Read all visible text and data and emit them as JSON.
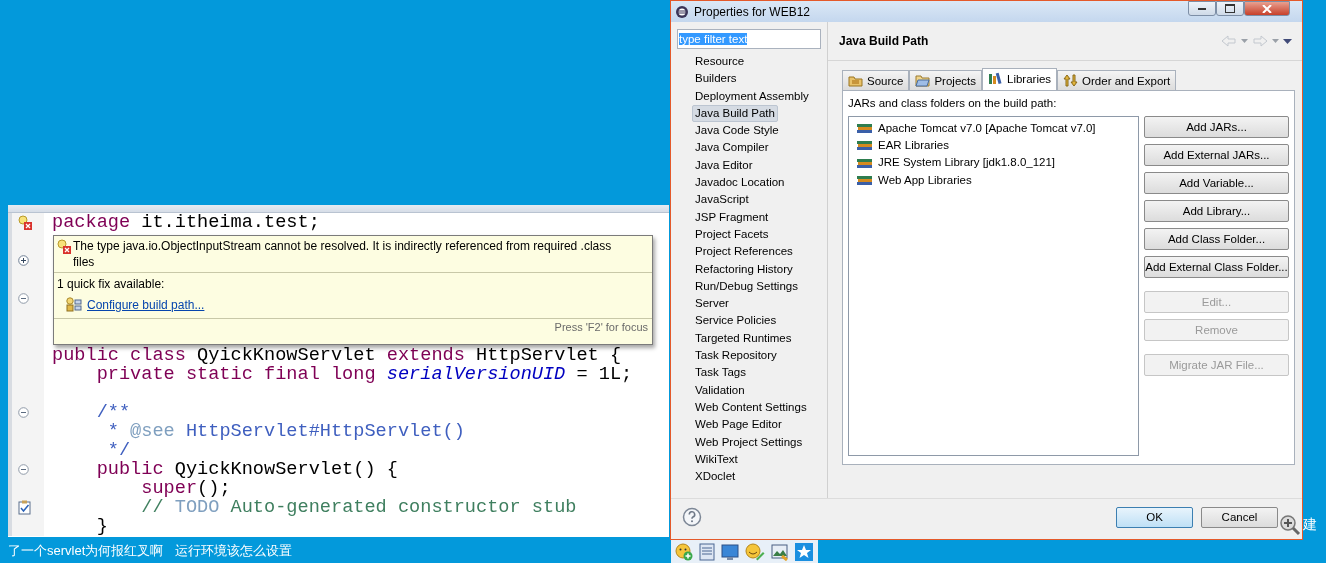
{
  "editor": {
    "lines": [
      {
        "kind": "code",
        "marker": {
          "kind": "error"
        },
        "segments": [
          {
            "kind": "keyword",
            "text": "package"
          },
          {
            "kind": "plain",
            "text": " it.itheima.test;"
          }
        ]
      },
      {
        "kind": "blank"
      },
      {
        "kind": "blank",
        "marker": {
          "kind": "expand"
        }
      },
      {
        "kind": "blank"
      },
      {
        "kind": "blank",
        "marker": {
          "kind": "collapse"
        }
      },
      {
        "kind": "blank"
      },
      {
        "kind": "blank"
      },
      {
        "kind": "code",
        "segments": [
          {
            "kind": "keyword",
            "text": "public class"
          },
          {
            "kind": "plain",
            "text": " QyickKnowServlet "
          },
          {
            "kind": "keyword",
            "text": "extends"
          },
          {
            "kind": "plain",
            "text": " HttpServlet {"
          }
        ]
      },
      {
        "kind": "code",
        "segments": [
          {
            "kind": "keyword",
            "text": "    private static final long"
          },
          {
            "kind": "field",
            "text": " serialVersionUID"
          },
          {
            "kind": "plain",
            "text": " = 1L;"
          }
        ]
      },
      {
        "kind": "blank"
      },
      {
        "kind": "code",
        "marker": {
          "kind": "collapse"
        },
        "segments": [
          {
            "kind": "javadoc",
            "text": "    /**"
          }
        ]
      },
      {
        "kind": "code",
        "segments": [
          {
            "kind": "javadoc",
            "text": "     * "
          },
          {
            "kind": "doctag",
            "text": "@see"
          },
          {
            "kind": "javadoc",
            "text": " HttpServlet#HttpServlet()"
          }
        ]
      },
      {
        "kind": "code",
        "segments": [
          {
            "kind": "javadoc",
            "text": "     */"
          }
        ]
      },
      {
        "kind": "code",
        "marker": {
          "kind": "collapse"
        },
        "segments": [
          {
            "kind": "keyword",
            "text": "    public"
          },
          {
            "kind": "plain",
            "text": " QyickKnowServlet() {"
          }
        ]
      },
      {
        "kind": "code",
        "segments": [
          {
            "kind": "keyword",
            "text": "        super"
          },
          {
            "kind": "plain",
            "text": "();"
          }
        ]
      },
      {
        "kind": "code",
        "marker": {
          "kind": "task"
        },
        "segments": [
          {
            "kind": "comment",
            "text": "        // "
          },
          {
            "kind": "todo",
            "text": "TODO"
          },
          {
            "kind": "comment",
            "text": " Auto-generated constructor stub"
          }
        ]
      },
      {
        "kind": "code",
        "segments": [
          {
            "kind": "plain",
            "text": "    }"
          }
        ]
      }
    ]
  },
  "hover": {
    "message": "The type java.io.ObjectInputStream cannot be resolved. It is indirectly referenced from required .class files",
    "fixes_heading": "1 quick fix available:",
    "fixes": [
      "Configure build path..."
    ],
    "hint": "Press 'F2' for focus"
  },
  "caption": [
    "了一个servlet为何报红叉啊",
    "运行环境该怎么设置"
  ],
  "dialog": {
    "title": "Properties for WEB12",
    "filter": {
      "value": "type filter text",
      "highlighted": true
    },
    "nav": [
      {
        "label": "Resource",
        "selected": false
      },
      {
        "label": "Builders",
        "selected": false
      },
      {
        "label": "Deployment Assembly",
        "selected": false
      },
      {
        "label": "Java Build Path",
        "selected": true
      },
      {
        "label": "Java Code Style",
        "selected": false
      },
      {
        "label": "Java Compiler",
        "selected": false
      },
      {
        "label": "Java Editor",
        "selected": false
      },
      {
        "label": "Javadoc Location",
        "selected": false
      },
      {
        "label": "JavaScript",
        "selected": false
      },
      {
        "label": "JSP Fragment",
        "selected": false
      },
      {
        "label": "Project Facets",
        "selected": false
      },
      {
        "label": "Project References",
        "selected": false
      },
      {
        "label": "Refactoring History",
        "selected": false
      },
      {
        "label": "Run/Debug Settings",
        "selected": false
      },
      {
        "label": "Server",
        "selected": false
      },
      {
        "label": "Service Policies",
        "selected": false
      },
      {
        "label": "Targeted Runtimes",
        "selected": false
      },
      {
        "label": "Task Repository",
        "selected": false
      },
      {
        "label": "Task Tags",
        "selected": false
      },
      {
        "label": "Validation",
        "selected": false
      },
      {
        "label": "Web Content Settings",
        "selected": false
      },
      {
        "label": "Web Page Editor",
        "selected": false
      },
      {
        "label": "Web Project Settings",
        "selected": false
      },
      {
        "label": "WikiText",
        "selected": false
      },
      {
        "label": "XDoclet",
        "selected": false
      }
    ],
    "page_title": "Java Build Path",
    "tabs": [
      {
        "label": "Source",
        "kind": "source",
        "selected": false
      },
      {
        "label": "Projects",
        "kind": "projects",
        "selected": false
      },
      {
        "label": "Libraries",
        "kind": "libraries",
        "selected": true
      },
      {
        "label": "Order and Export",
        "kind": "order",
        "selected": false
      }
    ],
    "list_label": "JARs and class folders on the build path:",
    "libraries": [
      "Apache Tomcat v7.0 [Apache Tomcat v7.0]",
      "EAR Libraries",
      "JRE System Library [jdk1.8.0_121]",
      "Web App Libraries"
    ],
    "button_groups": [
      [
        {
          "label": "Add JARs...",
          "disabled": false
        },
        {
          "label": "Add External JARs...",
          "disabled": false
        },
        {
          "label": "Add Variable...",
          "disabled": false
        },
        {
          "label": "Add Library...",
          "disabled": false
        },
        {
          "label": "Add Class Folder...",
          "disabled": false
        },
        {
          "label": "Add External Class Folder...",
          "disabled": false
        }
      ],
      [
        {
          "label": "Edit...",
          "disabled": true
        },
        {
          "label": "Remove",
          "disabled": true
        }
      ],
      [
        {
          "label": "Migrate JAR File...",
          "disabled": true
        }
      ]
    ],
    "footer_buttons": [
      {
        "label": "OK",
        "default": true
      },
      {
        "label": "Cancel",
        "default": false
      }
    ]
  },
  "side_text": "建"
}
